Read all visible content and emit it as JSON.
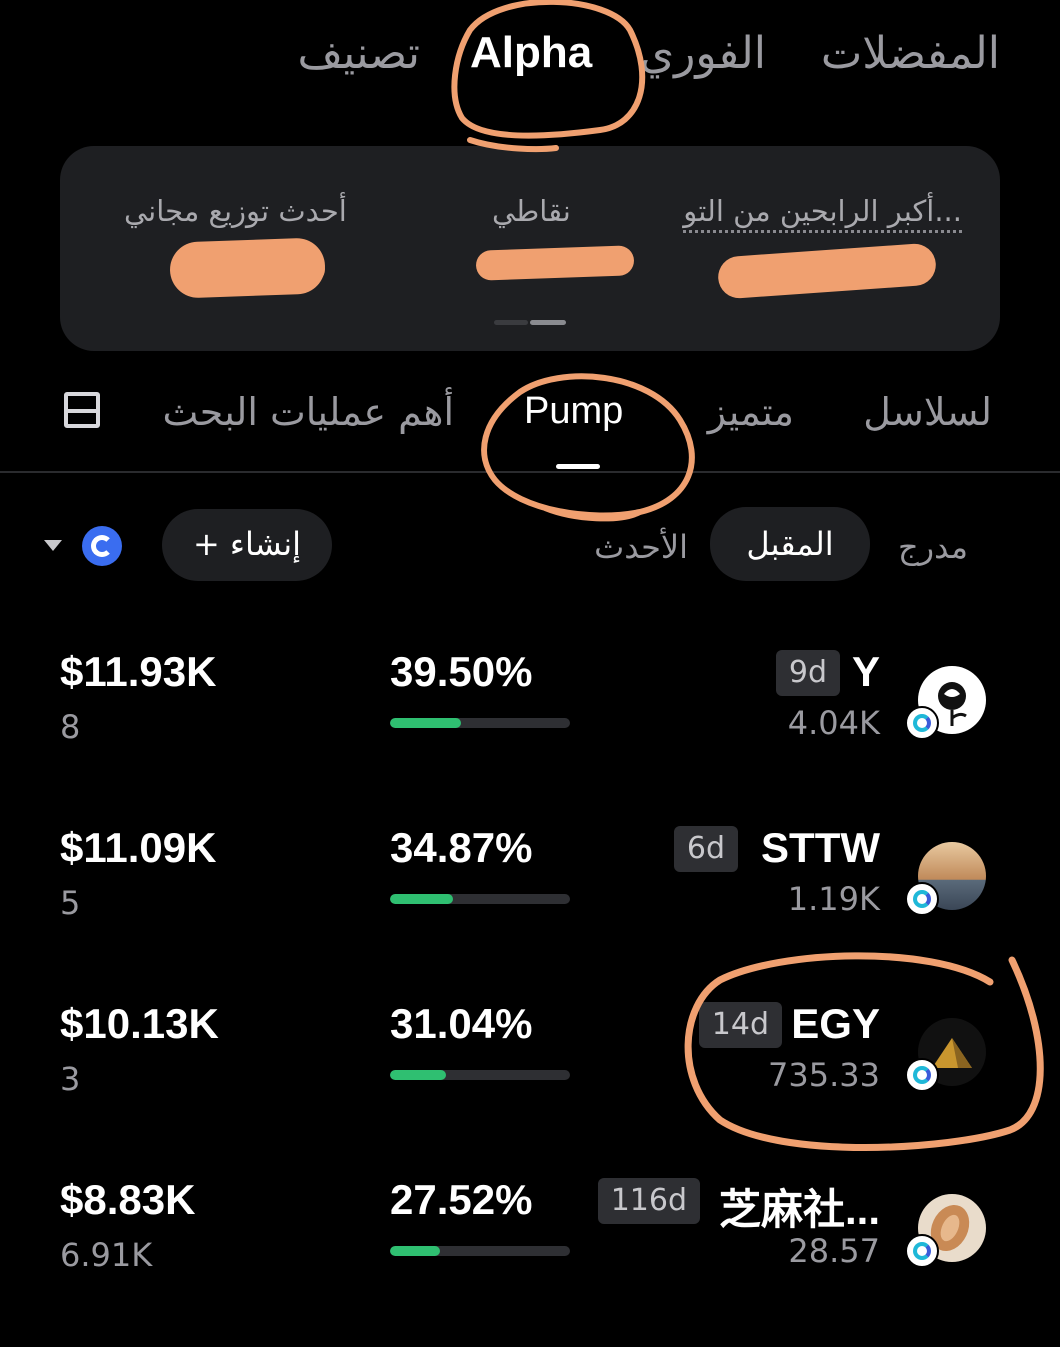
{
  "top_tabs": {
    "favorites": "المفضلات",
    "spot": "الفوري",
    "alpha": "Alpha",
    "rank": "تصنيف"
  },
  "stats": {
    "top_gainers": "أكبر الرابحين من التو...",
    "my_points": "نقاطي",
    "latest_airdrop": "أحدث توزيع مجاني"
  },
  "categories": {
    "chains": "لسلاسل",
    "featured": "متميز",
    "pump": "Pump",
    "top_search": "أهم عمليات البحث"
  },
  "filters": {
    "listed": "مدرج",
    "upcoming": "المقبل",
    "newest": "الأحدث",
    "create": "+ إنشاء"
  },
  "tokens": [
    {
      "market_cap": "$11.93K",
      "count": "8",
      "progress_label": "39.50%",
      "progress": 0.395,
      "name": "Y",
      "age": "9d",
      "volume": "4.04K"
    },
    {
      "market_cap": "$11.09K",
      "count": "5",
      "progress_label": "34.87%",
      "progress": 0.3487,
      "name": "STTW",
      "age": "6d",
      "volume": "1.19K"
    },
    {
      "market_cap": "$10.13K",
      "count": "3",
      "progress_label": "31.04%",
      "progress": 0.3104,
      "name": "EGY",
      "age": "14d",
      "volume": "735.33"
    },
    {
      "market_cap": "$8.83K",
      "count": "6.91K",
      "progress_label": "27.52%",
      "progress": 0.2752,
      "name": "芝麻社...",
      "age": "116d",
      "volume": "28.57"
    }
  ],
  "colors": {
    "background": "#000000",
    "card": "#1e1f22",
    "progress_fill": "#2fbf71",
    "annotation": "#f0a070",
    "chain_badge": "#3a6df0"
  },
  "icons": {
    "layout": "layout-toggle-icon",
    "chain": "chain-selector-icon",
    "dropdown": "caret-down-icon"
  }
}
